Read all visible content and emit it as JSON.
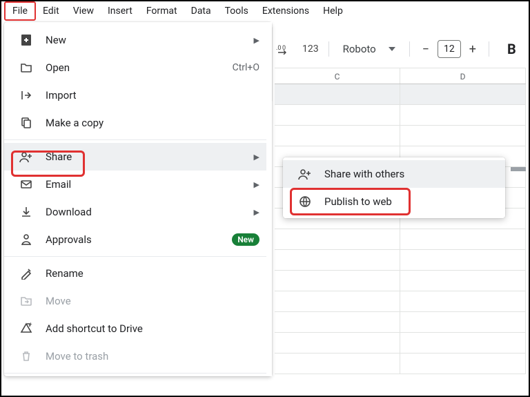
{
  "menubar": [
    "File",
    "Edit",
    "View",
    "Insert",
    "Format",
    "Data",
    "Tools",
    "Extensions",
    "Help"
  ],
  "toolbar": {
    "decimal_icon": ".00→",
    "num_format": "123",
    "font_name": "Roboto",
    "font_size": "12",
    "bold": "B"
  },
  "file_menu": {
    "new": "New",
    "open": "Open",
    "open_shortcut": "Ctrl+O",
    "import": "Import",
    "make_copy": "Make a copy",
    "share": "Share",
    "email": "Email",
    "download": "Download",
    "approvals": "Approvals",
    "approvals_badge": "New",
    "rename": "Rename",
    "move": "Move",
    "add_shortcut": "Add shortcut to Drive",
    "move_to_trash": "Move to trash"
  },
  "share_submenu": {
    "share_others": "Share with others",
    "publish_web": "Publish to web"
  },
  "columns": [
    "C",
    "D"
  ]
}
